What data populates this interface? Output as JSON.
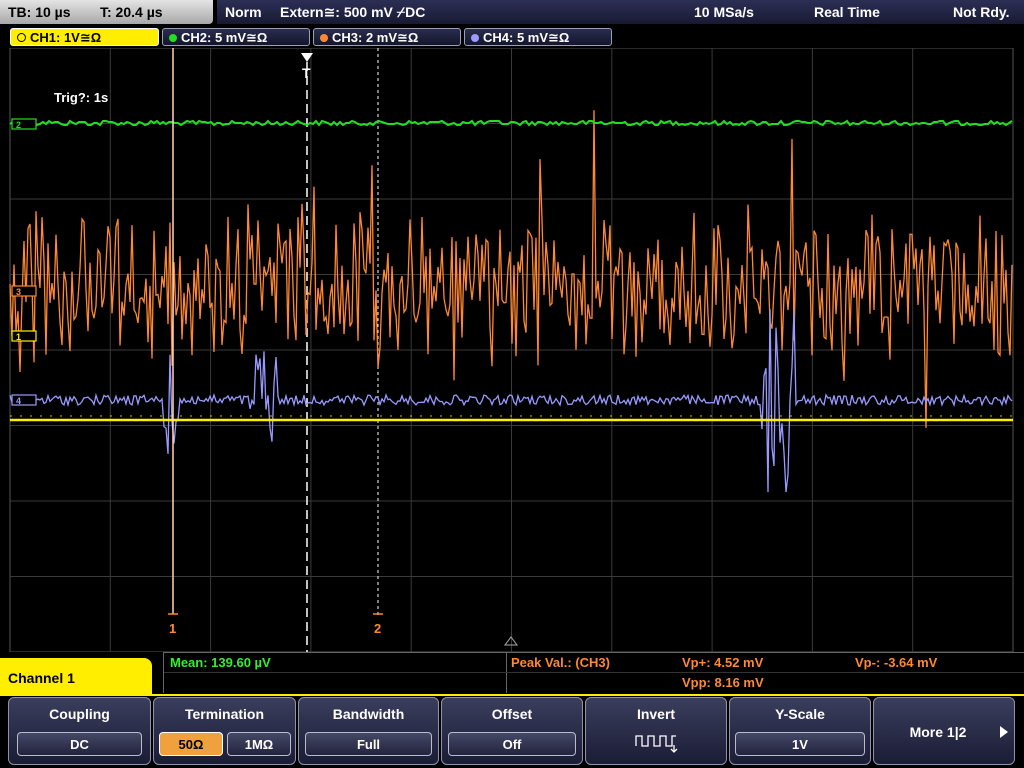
{
  "status": {
    "timebase": "TB: 10 µs",
    "trigger_time": "T: 20.4 µs",
    "mode": "Norm",
    "trigger_source": "Extern≅: 500 mV ⌿DC",
    "sample_rate": "10 MSa/s",
    "acq_mode": "Real Time",
    "ready_state": "Not Rdy."
  },
  "tabs": [
    {
      "label": "CH1: 1V≅Ω",
      "color": "#ffee00"
    },
    {
      "label": "CH2: 5 mV≅Ω",
      "color": "#22dd22"
    },
    {
      "label": "CH3: 2 mV≅Ω",
      "color": "#ff8833"
    },
    {
      "label": "CH4: 5 mV≅Ω",
      "color": "#9999ff"
    }
  ],
  "screen": {
    "trigger_info": "Trig?: 1s",
    "trigger_marker": "T",
    "cursor1_label": "1",
    "cursor2_label": "2",
    "ch_markers": [
      "2",
      "3",
      "1",
      "4"
    ]
  },
  "measurements": {
    "mean": "Mean: 139.60 µV",
    "peak_label": "Peak Val.:  (CH3)",
    "vp_plus": "Vp+: 4.52 mV",
    "vp_minus": "Vp-: -3.64 mV",
    "vpp": "Vpp: 8.16 mV"
  },
  "channel_label": "Channel 1",
  "softkeys": {
    "coupling": {
      "title": "Coupling",
      "value": "DC"
    },
    "termination": {
      "title": "Termination",
      "opt1": "50Ω",
      "opt2": "1MΩ"
    },
    "bandwidth": {
      "title": "Bandwidth",
      "value": "Full"
    },
    "offset": {
      "title": "Offset",
      "value": "Off"
    },
    "invert": {
      "title": "Invert",
      "icon": "square-wave-icon"
    },
    "yscale": {
      "title": "Y-Scale",
      "value": "1V"
    },
    "more": {
      "label": "More 1|2"
    }
  },
  "colors": {
    "ch1": "#ffee00",
    "ch2": "#22dd22",
    "ch3": "#ff8833",
    "ch4": "#9999ff",
    "grid": "#3a3a3a",
    "measure_green": "#33ee33",
    "measure_orange": "#ff8833"
  }
}
